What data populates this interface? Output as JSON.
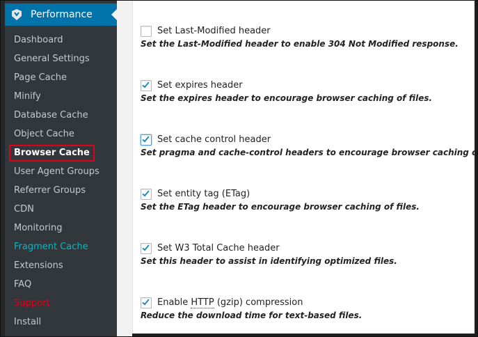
{
  "sidebar": {
    "title": "Performance",
    "items": [
      {
        "label": "Dashboard"
      },
      {
        "label": "General Settings"
      },
      {
        "label": "Page Cache"
      },
      {
        "label": "Minify"
      },
      {
        "label": "Database Cache"
      },
      {
        "label": "Object Cache"
      },
      {
        "label": "Browser Cache",
        "current": true
      },
      {
        "label": "User Agent Groups"
      },
      {
        "label": "Referrer Groups"
      },
      {
        "label": "CDN"
      },
      {
        "label": "Monitoring"
      },
      {
        "label": "Fragment Cache"
      },
      {
        "label": "Extensions"
      },
      {
        "label": "FAQ"
      },
      {
        "label": "Support"
      },
      {
        "label": "Install"
      }
    ]
  },
  "options": [
    {
      "label": "Set Last-Modified header",
      "description": "Set the Last-Modified header to enable 304 Not Modified response.",
      "checked": false
    },
    {
      "label": "Set expires header",
      "description": "Set the expires header to encourage browser caching of files.",
      "checked": true
    },
    {
      "label": "Set cache control header",
      "description": "Set pragma and cache-control headers to encourage browser caching of files.",
      "checked": true
    },
    {
      "label": "Set entity tag (ETag)",
      "description": "Set the ETag header to encourage browser caching of files.",
      "checked": true
    },
    {
      "label": "Set W3 Total Cache header",
      "description": "Set this header to assist in identifying optimized files.",
      "checked": true
    },
    {
      "label_prefix": "Enable ",
      "label_abbr": "HTTP",
      "label_suffix": " (gzip) compression",
      "description": "Reduce the download time for text-based files.",
      "checked": true
    }
  ],
  "colors": {
    "menu_accent": "#0073aa",
    "current_highlight": "#e2001a",
    "fragment_cache": "#00b9c4",
    "support": "#e0001b",
    "check": "#1e8cbe"
  }
}
